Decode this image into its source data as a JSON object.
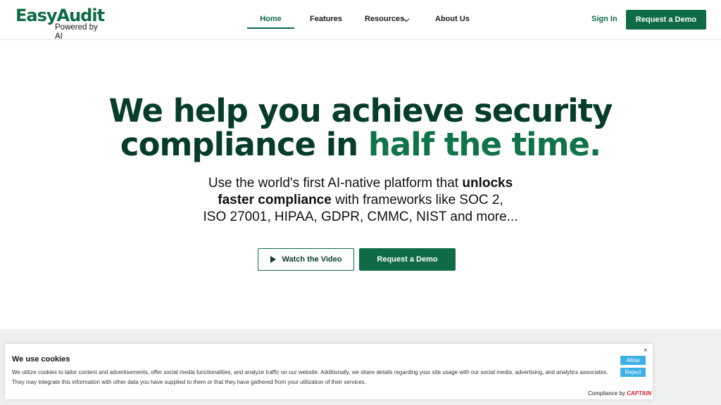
{
  "nav": {
    "logo_main": "EasyAudit",
    "logo_sub": "Powered by AI",
    "links": [
      "Home",
      "Features",
      "Resources",
      "About Us"
    ],
    "sign_in": "Sign In",
    "demo_button": "Request a Demo",
    "active_link": "Home"
  },
  "hero": {
    "headline_line1": "We help you achieve security",
    "headline_line2a": "compliance in ",
    "headline_line2b": "half the time.",
    "sub_line1a": "Use the world's first AI-native platform that ",
    "sub_line1b": "unlocks",
    "sub_line2a": "faster compliance",
    "sub_line2b": " with frameworks like SOC 2,",
    "sub_line3": "ISO 27001, HIPAA, GDPR, CMMC, NIST and more...",
    "watch_video": "Watch the Video",
    "request_demo": "Request a Demo"
  },
  "cookie": {
    "title": "We use cookies",
    "body": "We utilize cookies to tailor content and advertisements, offer social media functionalities, and analyze traffic on our website. Additionally, we share details regarding your site usage with our social media, advertising, and analytics associates. They may integrate this information with other data you have supplied to them or that they have gathered from your utilization of their services.",
    "allow": "Allow",
    "reject": "Reject",
    "close": "×",
    "footer_prefix": "Compliance by ",
    "footer_brand": "CAPTAIN"
  },
  "colors": {
    "brand_green": "#0e6b45",
    "headline_dark": "#063c2a",
    "cookie_button": "#3fb0e6"
  },
  "icons": {
    "play": "play-icon",
    "dropdown": "chevron-down-icon",
    "close": "close-icon"
  }
}
